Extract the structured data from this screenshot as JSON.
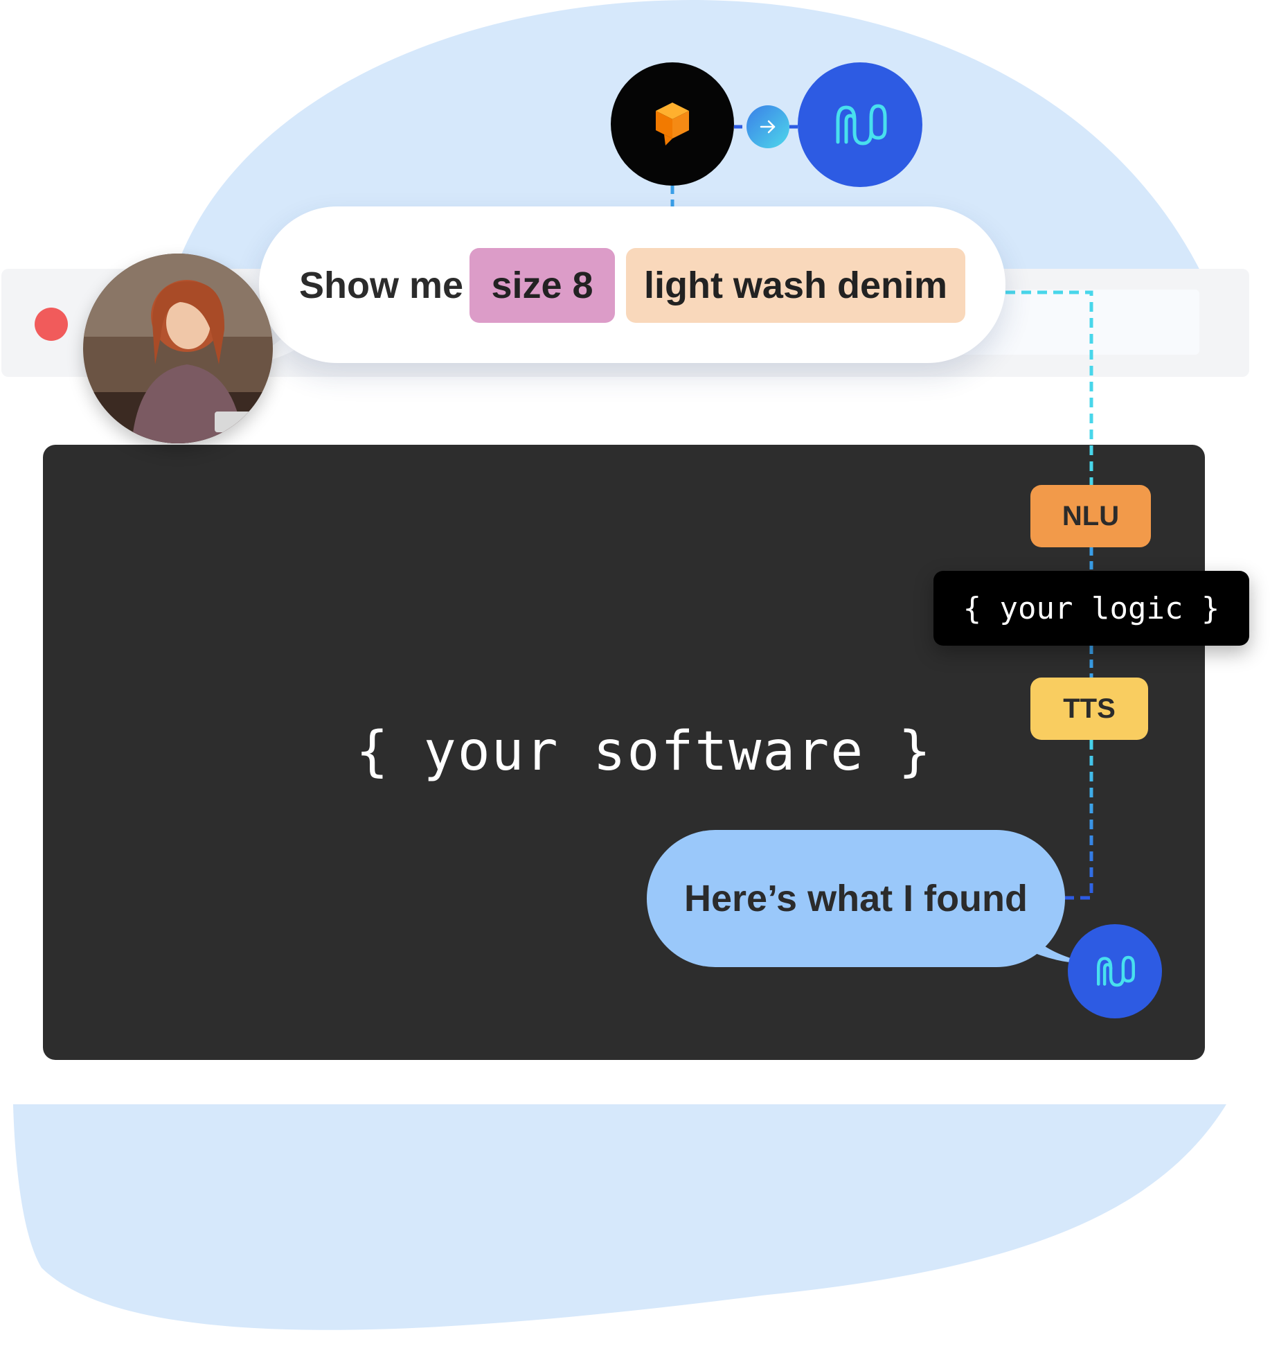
{
  "colors": {
    "blob": "#d6e8fb",
    "panel": "#2d2d2d",
    "brand_blue": "#2d5be3",
    "chip_size": "#dc9cc8",
    "chip_denim": "#f9d8bb",
    "nlu": "#f29a4a",
    "tts": "#f9cd60",
    "reply_bubble": "#9ac8fa",
    "wire_cyan": "#48d6ea",
    "wire_blue": "#2d5be3"
  },
  "icons": {
    "voice_source": "orange-cube-speech-icon",
    "brand": "wave-logo-icon",
    "arrow": "arrow-right-icon",
    "window_control": "close-dot-icon",
    "user": "user-avatar-photo"
  },
  "utterance": {
    "prefix": "Show me",
    "entities": [
      {
        "text": "size 8"
      },
      {
        "text": "light wash denim"
      }
    ]
  },
  "software": {
    "label": "{ your software }"
  },
  "pipeline": {
    "nlu": "NLU",
    "logic": "{ your logic }",
    "tts": "TTS"
  },
  "reply": {
    "text": "Here’s what I found"
  }
}
